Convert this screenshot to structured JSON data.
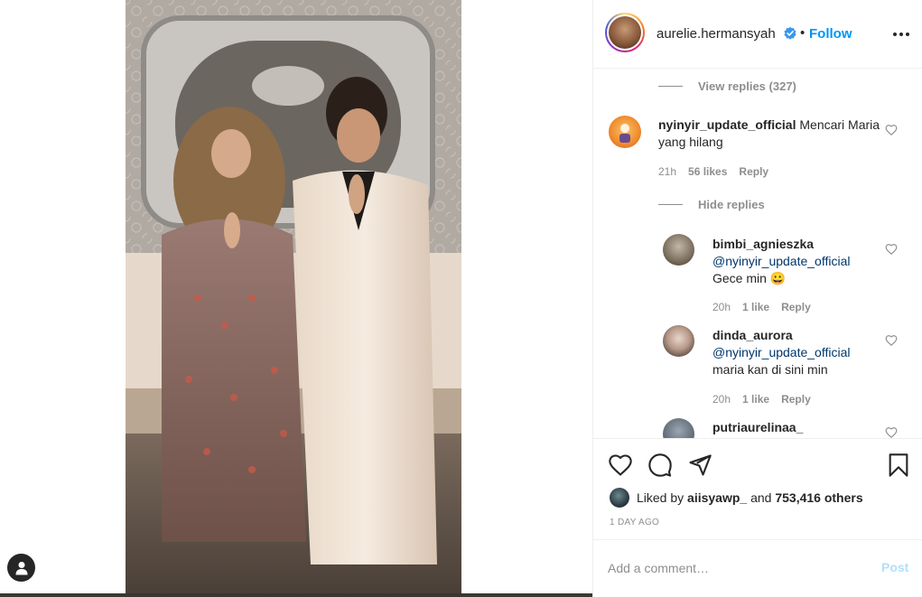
{
  "post": {
    "author": "aurelie.hermansyah",
    "separator": "•",
    "follow_label": "Follow"
  },
  "comments": {
    "view_replies_label": "View replies (327)",
    "thread": {
      "username": "nyinyir_update_official",
      "text": "Mencari Maria yang hilang",
      "time": "21h",
      "likes": "56 likes",
      "reply_label": "Reply",
      "hide_replies_label": "Hide replies"
    },
    "replies": [
      {
        "username": "bimbi_agnieszka",
        "mention": "@nyinyir_update_official",
        "text": "Gece min 😀",
        "time": "20h",
        "likes": "1 like",
        "reply_label": "Reply"
      },
      {
        "username": "dinda_aurora",
        "mention": "@nyinyir_update_official",
        "text": "maria kan di sini min",
        "time": "20h",
        "likes": "1 like",
        "reply_label": "Reply"
      },
      {
        "username": "putriaurelinaa_"
      }
    ]
  },
  "likes": {
    "prefix": "Liked by",
    "liker": "aiisyawp_",
    "conj": "and",
    "others": "753,416 others"
  },
  "timestamp": "1 DAY AGO",
  "comment_form": {
    "placeholder": "Add a comment…",
    "post_label": "Post"
  },
  "colors": {
    "accent": "#0095f6",
    "post_disabled": "#b2dffc",
    "muted": "#8e8e8e",
    "mention": "#00376b"
  },
  "icons": [
    "verified-icon",
    "more-options-icon",
    "heart-icon",
    "comment-icon",
    "share-icon",
    "bookmark-icon",
    "user-icon"
  ]
}
